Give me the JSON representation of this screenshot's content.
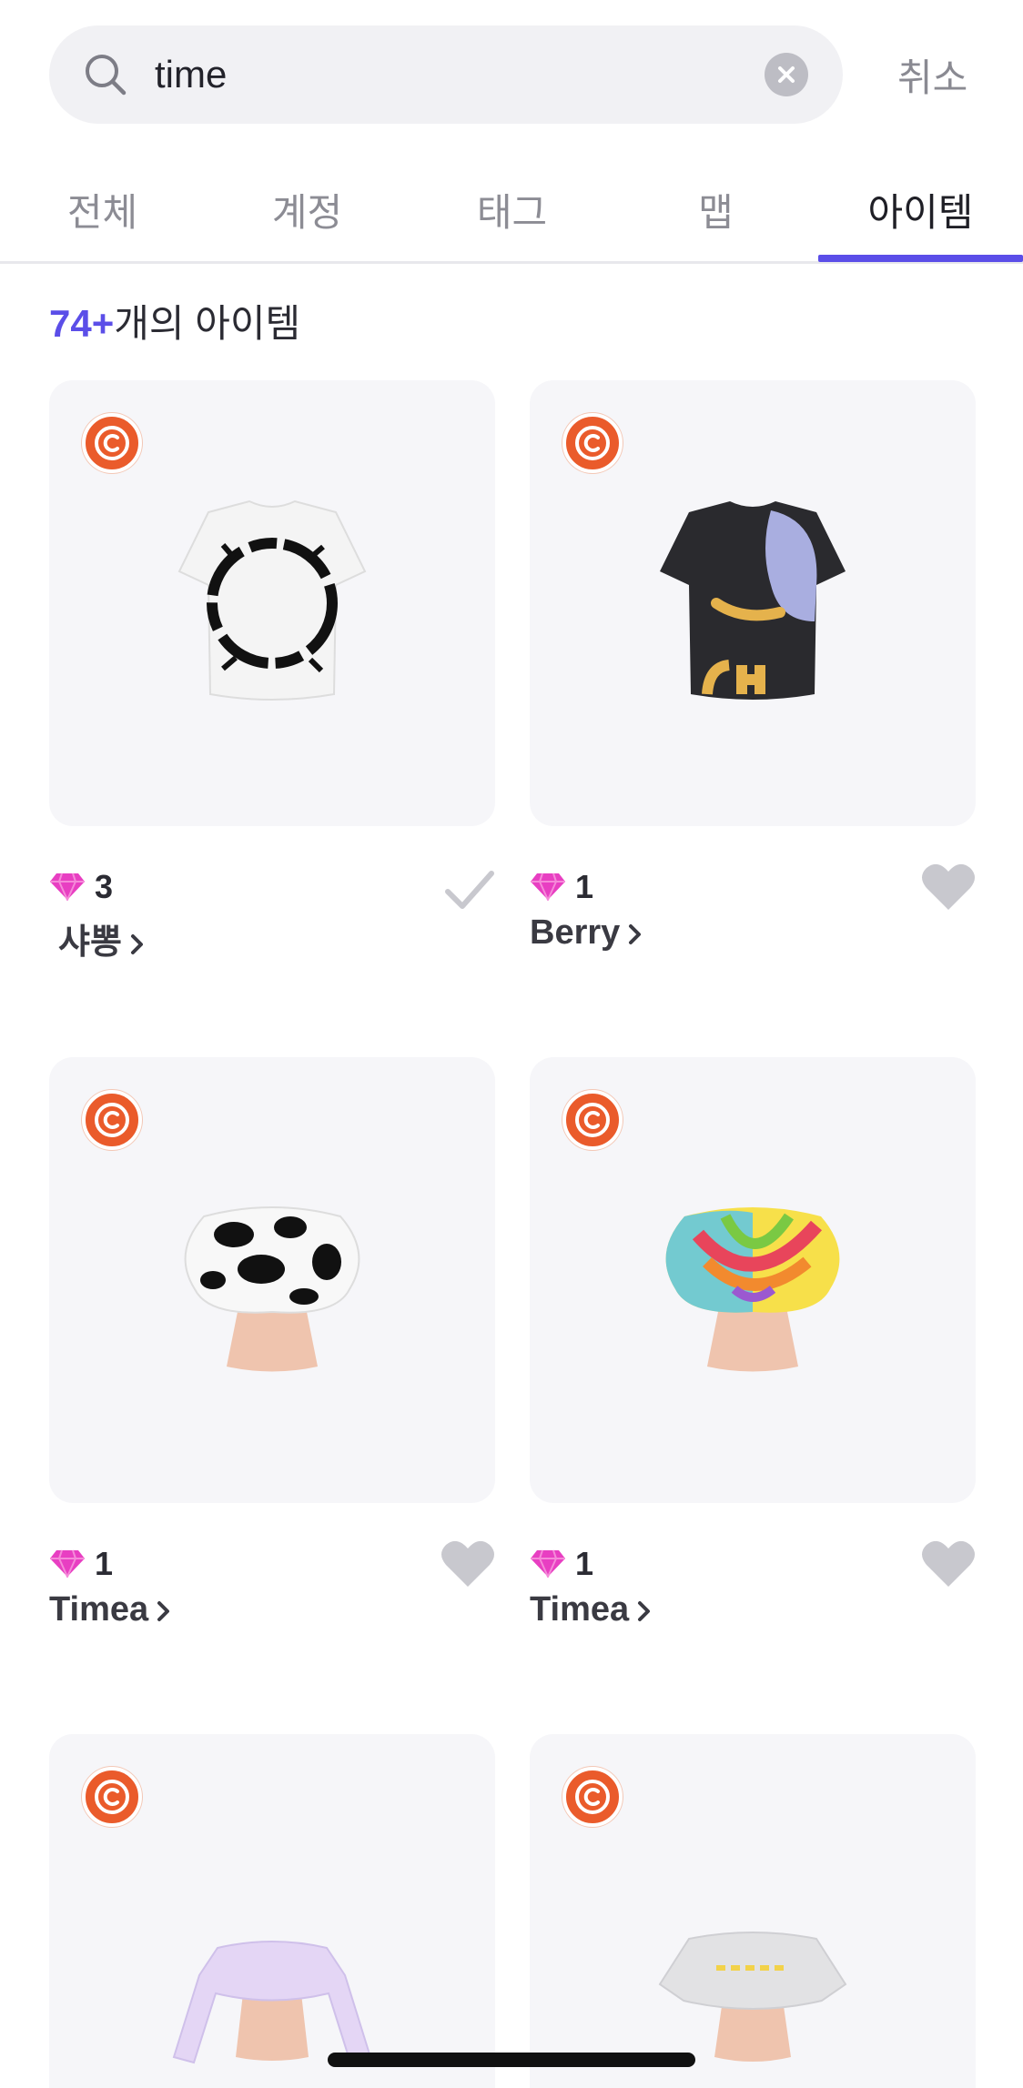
{
  "search": {
    "value": "time",
    "cancel_label": "취소"
  },
  "tabs": [
    {
      "label": "전체",
      "active": false
    },
    {
      "label": "계정",
      "active": false
    },
    {
      "label": "태그",
      "active": false
    },
    {
      "label": "맵",
      "active": false
    },
    {
      "label": "아이템",
      "active": true
    }
  ],
  "results": {
    "count": "74+",
    "suffix": "개의 아이템"
  },
  "colors": {
    "accent": "#5b4ee8",
    "badge": "#ea5b2b",
    "gem": "#e83fc2"
  },
  "items": [
    {
      "price": "3",
      "creator": "샤뽕",
      "status_icon": "check-icon",
      "thumb": "white-shirt"
    },
    {
      "price": "1",
      "creator": "Berry",
      "status_icon": "heart-icon",
      "thumb": "black-shirt"
    },
    {
      "price": "1",
      "creator": "Timea",
      "status_icon": "heart-icon",
      "thumb": "cow-crop-top"
    },
    {
      "price": "1",
      "creator": "Timea",
      "status_icon": "heart-icon",
      "thumb": "tie-dye-crop-top"
    },
    {
      "price": "",
      "creator": "",
      "status_icon": "",
      "thumb": "lavender-sweater"
    },
    {
      "price": "",
      "creator": "",
      "status_icon": "",
      "thumb": "gray-crop-tee"
    }
  ]
}
